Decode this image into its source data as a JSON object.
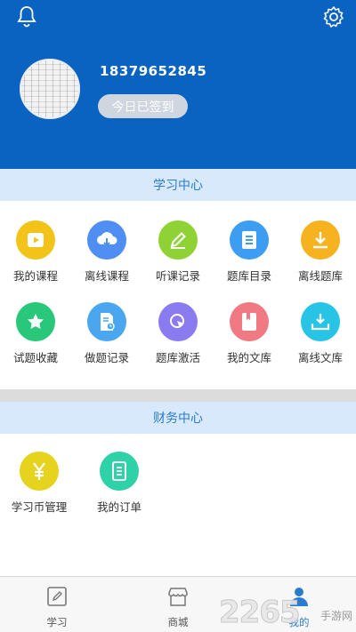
{
  "header": {
    "phone": "18379652845",
    "signin_label": "今日已签到"
  },
  "study_center": {
    "title": "学习中心",
    "items": [
      {
        "label": "我的课程",
        "icon": "play-icon",
        "color": "#f2c318"
      },
      {
        "label": "离线课程",
        "icon": "cloud-download-icon",
        "color": "#4f8ef2"
      },
      {
        "label": "听课记录",
        "icon": "pencil-icon",
        "color": "#8fd236"
      },
      {
        "label": "题库目录",
        "icon": "list-icon",
        "color": "#3d9df0"
      },
      {
        "label": "离线题库",
        "icon": "download-icon",
        "color": "#f6b21f"
      },
      {
        "label": "试题收藏",
        "icon": "star-icon",
        "color": "#29c77a"
      },
      {
        "label": "做题记录",
        "icon": "document-clock-icon",
        "color": "#4aa6ef"
      },
      {
        "label": "题库激活",
        "icon": "cursor-icon",
        "color": "#8a7cf0"
      },
      {
        "label": "我的文库",
        "icon": "book-icon",
        "color": "#f07a83"
      },
      {
        "label": "离线文库",
        "icon": "tray-download-icon",
        "color": "#28c4e6"
      }
    ]
  },
  "finance_center": {
    "title": "财务中心",
    "items": [
      {
        "label": "学习币管理",
        "icon": "yen-icon",
        "color": "#e6d31d"
      },
      {
        "label": "我的订单",
        "icon": "order-icon",
        "color": "#2fd1a8"
      }
    ]
  },
  "bottom_nav": {
    "items": [
      {
        "label": "学习",
        "icon": "edit-icon"
      },
      {
        "label": "商城",
        "icon": "store-icon"
      },
      {
        "label": "我的",
        "icon": "person-icon",
        "active": true
      }
    ]
  },
  "watermark": {
    "number": "2265",
    "text": "手游网"
  }
}
